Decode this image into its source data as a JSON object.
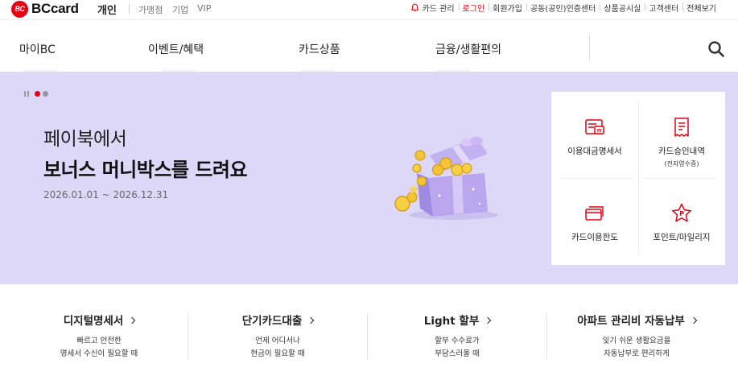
{
  "brand": {
    "logo_mark": "BC",
    "logo_text": "BCcard",
    "accent_color": "#e60012"
  },
  "segments": {
    "personal": "개인",
    "merchant": "가맹점",
    "corporate": "기업",
    "vip": "VIP"
  },
  "utility": {
    "card_manage": "카드 관리",
    "login": "로그인",
    "join": "회원가입",
    "cert_center": "공동(공인)인증센터",
    "product_notice": "상품공시실",
    "customer_center": "고객센터",
    "view_all": "전체보기"
  },
  "nav": {
    "items": [
      "마이BC",
      "이벤트/혜택",
      "카드상품",
      "금융/생활편의"
    ],
    "search_icon": "search-icon"
  },
  "hero": {
    "background": "#ddd8f7",
    "headline_1": "페이북에서",
    "headline_2": "보너스 머니박스를 드려요",
    "period": "2026.01.01 ~ 2026.12.31",
    "slide_current": 1,
    "slide_total": 2
  },
  "quick_menu": [
    {
      "label": "이용대금명세서",
      "sub": "",
      "icon": "bill-statement-icon"
    },
    {
      "label": "카드승인내역",
      "sub": "(전자영수증)",
      "icon": "receipt-icon"
    },
    {
      "label": "카드이용한도",
      "sub": "",
      "icon": "card-limit-icon"
    },
    {
      "label": "포인트/마일리지",
      "sub": "",
      "icon": "point-star-icon"
    }
  ],
  "services": [
    {
      "title": "디지털명세서",
      "desc_1": "빠르고 안전한",
      "desc_2": "명세서 수신이 필요할 때"
    },
    {
      "title": "단기카드대출",
      "desc_1": "언제 어디서나",
      "desc_2": "현금이 필요할 때"
    },
    {
      "title": "Light 할부",
      "desc_1": "할부 수수료가",
      "desc_2": "부담스러울 때"
    },
    {
      "title": "아파트 관리비 자동납부",
      "desc_1": "잊기 쉬운 생활요금을",
      "desc_2": "자동납부로 편리하게"
    }
  ]
}
